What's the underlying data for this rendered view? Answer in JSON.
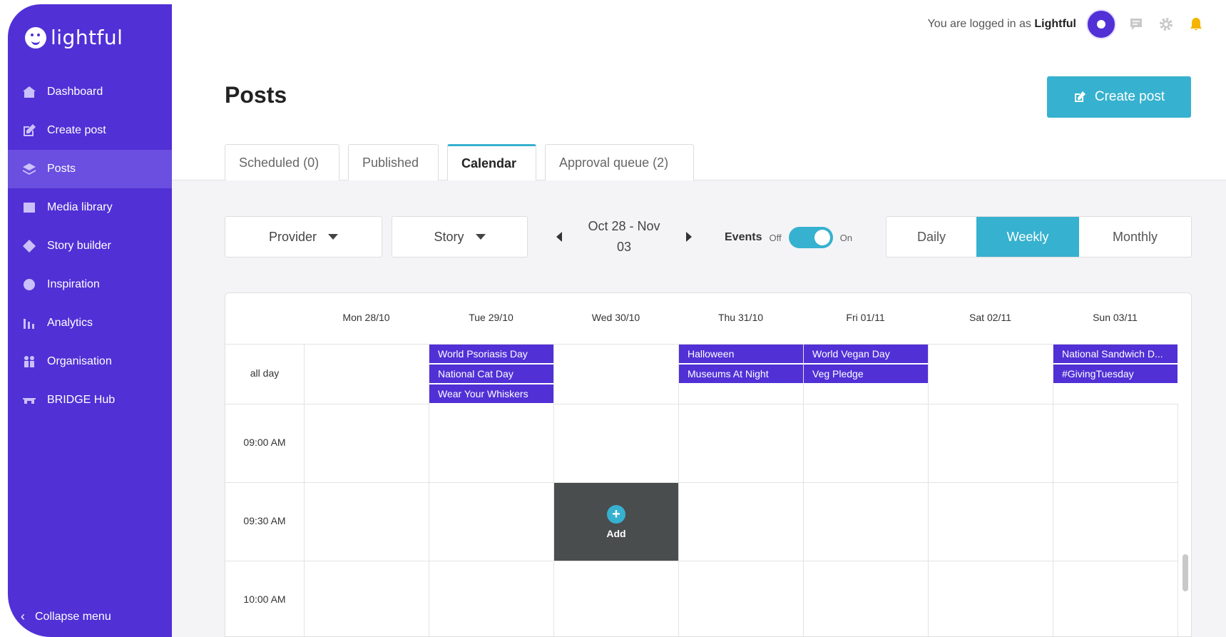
{
  "app": {
    "logo_text": "lightful"
  },
  "sidebar": {
    "items": [
      {
        "label": "Dashboard",
        "icon": "home-icon"
      },
      {
        "label": "Create post",
        "icon": "edit-icon"
      },
      {
        "label": "Posts",
        "icon": "layers-icon",
        "active": true
      },
      {
        "label": "Media library",
        "icon": "image-icon"
      },
      {
        "label": "Story builder",
        "icon": "story-icon"
      },
      {
        "label": "Inspiration",
        "icon": "lightbulb-icon"
      },
      {
        "label": "Analytics",
        "icon": "bar-chart-icon"
      },
      {
        "label": "Organisation",
        "icon": "people-icon"
      },
      {
        "label": "BRIDGE Hub",
        "icon": "bridge-icon"
      }
    ],
    "collapse_label": "Collapse menu"
  },
  "header": {
    "logged_prefix": "You are logged in as",
    "user_name": "Lightful"
  },
  "page": {
    "title": "Posts",
    "create_button": "Create post"
  },
  "tabs": [
    {
      "label": "Scheduled (0)"
    },
    {
      "label": "Published"
    },
    {
      "label": "Calendar",
      "active": true
    },
    {
      "label": "Approval queue (2)"
    }
  ],
  "filters": {
    "provider": "Provider",
    "story": "Story",
    "date_range_line1": "Oct 28 - Nov",
    "date_range_line2": "03",
    "events_label": "Events",
    "events_off": "Off",
    "events_on": "On",
    "events_enabled": true,
    "views": [
      "Daily",
      "Weekly",
      "Monthly"
    ],
    "active_view": "Weekly"
  },
  "calendar": {
    "days": [
      "Mon 28/10",
      "Tue 29/10",
      "Wed 30/10",
      "Thu 31/10",
      "Fri 01/11",
      "Sat 02/11",
      "Sun 03/11"
    ],
    "all_day_label": "all day",
    "times": [
      "09:00 AM",
      "09:30 AM",
      "10:00 AM"
    ],
    "all_day_events": [
      {
        "day": 1,
        "row": 0,
        "label": "World Psoriasis Day"
      },
      {
        "day": 1,
        "row": 1,
        "label": "National Cat Day"
      },
      {
        "day": 1,
        "row": 2,
        "label": "Wear Your Whiskers"
      },
      {
        "day": 3,
        "row": 0,
        "label": "Halloween"
      },
      {
        "day": 3,
        "row": 1,
        "label": "Museums At Night"
      },
      {
        "day": 4,
        "row": 0,
        "label": "World Vegan Day"
      },
      {
        "day": 4,
        "row": 1,
        "label": "Veg Pledge"
      },
      {
        "day": 6,
        "row": 0,
        "label": "National Sandwich D..."
      },
      {
        "day": 6,
        "row": 1,
        "label": "#GivingTuesday"
      }
    ],
    "add_label": "Add",
    "add_cell": {
      "day": 2,
      "time": "09:30 AM"
    }
  },
  "colors": {
    "brand": "#5130d6",
    "accent": "#36b1cf"
  }
}
